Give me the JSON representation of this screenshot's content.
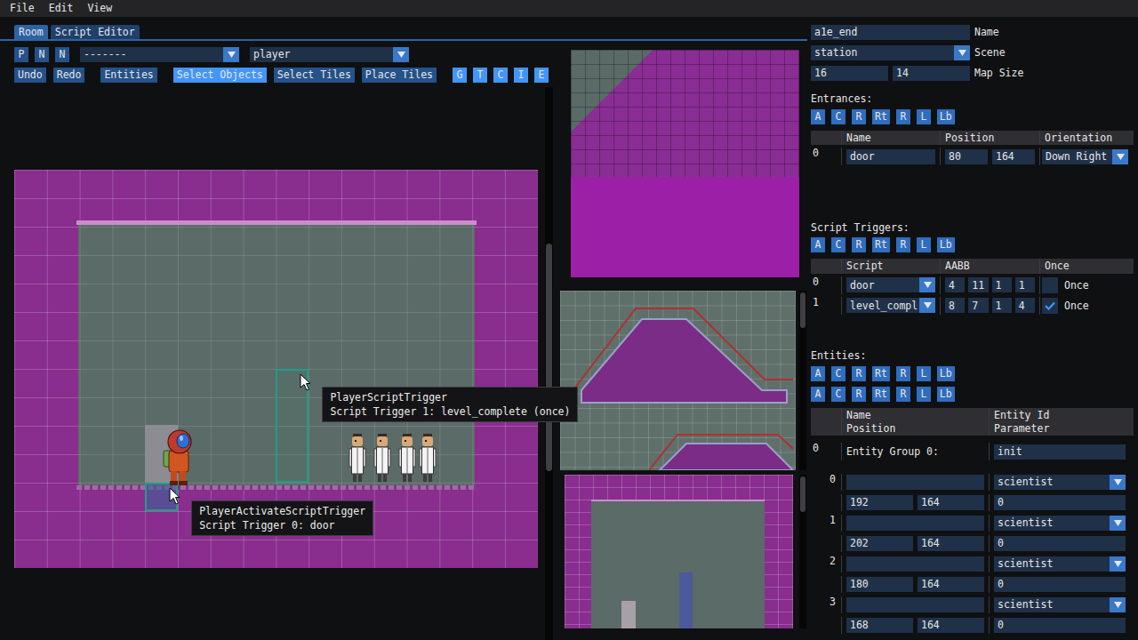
{
  "menu": [
    {
      "label": "File"
    },
    {
      "label": "Edit"
    },
    {
      "label": "View"
    }
  ],
  "tabs": [
    {
      "label": "Room",
      "selected": true
    },
    {
      "label": "Script Editor",
      "selected": false
    }
  ],
  "toolbar": {
    "quick_buttons": [
      "P",
      "N",
      "N"
    ],
    "dropdowns": [
      "-------",
      "player"
    ],
    "action_groups": [
      [
        {
          "label": "Undo",
          "selected": false
        },
        {
          "label": "Redo",
          "selected": false
        }
      ],
      [
        {
          "label": "Entities",
          "selected": false
        }
      ],
      [
        {
          "label": "Select Objects",
          "selected": true
        },
        {
          "label": "Select Tiles",
          "selected": false
        },
        {
          "label": "Place Tiles",
          "selected": false
        }
      ],
      [
        {
          "label": "G",
          "selected": true
        },
        {
          "label": "T",
          "selected": true
        },
        {
          "label": "C",
          "selected": true
        },
        {
          "label": "I",
          "selected": true
        },
        {
          "label": "E",
          "selected": true
        }
      ]
    ]
  },
  "room_view": {
    "scroll": {
      "start": 0.283,
      "size": 0.412
    }
  },
  "room": {
    "fields": [
      {
        "label": "Name",
        "kind": "input",
        "values": [
          "a1e_end"
        ]
      },
      {
        "label": "Scene",
        "kind": "dropdown",
        "values": [
          "station"
        ]
      },
      {
        "label": "Map Size",
        "kind": "pair",
        "values": [
          "16",
          "14"
        ]
      }
    ]
  },
  "entrances": {
    "label": "Entrances:",
    "buttons": [
      "A",
      "C",
      "R",
      "Rt",
      "R",
      "L",
      "Lb"
    ],
    "columns": [
      "Name",
      "Position",
      "Orientation"
    ],
    "rows": [
      {
        "index": "0",
        "name": "door",
        "x": "80",
        "y": "164",
        "orientation": "Down Right"
      }
    ]
  },
  "script_triggers": {
    "label": "Script Triggers:",
    "buttons": [
      "A",
      "C",
      "R",
      "Rt",
      "R",
      "L",
      "Lb"
    ],
    "columns": [
      "Script",
      "AABB",
      "Once"
    ],
    "rows": [
      {
        "index": "0",
        "script": "door",
        "aabb": [
          "4",
          "11",
          "1",
          "1"
        ],
        "once": false,
        "once_label": "Once",
        "tooltip": {
          "title": "PlayerActivateScriptTrigger",
          "text": "Script Trigger 0: door"
        }
      },
      {
        "index": "1",
        "script": "level_compl",
        "aabb": [
          "8",
          "7",
          "1",
          "4"
        ],
        "once": true,
        "once_label": "Once",
        "tooltip": {
          "title": "PlayerScriptTrigger",
          "text": "Script Trigger 1: level_complete (once)"
        }
      }
    ]
  },
  "entities": {
    "label": "Entities:",
    "button_rows": [
      [
        "A",
        "C",
        "R",
        "Rt",
        "R",
        "L",
        "Lb"
      ],
      [
        "A",
        "C",
        "R",
        "Rt",
        "R",
        "L",
        "Lb"
      ]
    ],
    "columns": [
      [
        "Name",
        "Position"
      ],
      [
        "Entity Id",
        "Parameter"
      ]
    ],
    "groups": [
      {
        "index": "0",
        "label": "Entity Group 0:",
        "id": "init",
        "items": [
          {
            "index": "0",
            "name": "",
            "entity_id": "scientist",
            "x": "192",
            "y": "164",
            "parameter": "0"
          },
          {
            "index": "1",
            "name": "",
            "entity_id": "scientist",
            "x": "202",
            "y": "164",
            "parameter": "0"
          },
          {
            "index": "2",
            "name": "",
            "entity_id": "scientist",
            "x": "180",
            "y": "164",
            "parameter": "0"
          },
          {
            "index": "3",
            "name": "",
            "entity_id": "scientist",
            "x": "168",
            "y": "164",
            "parameter": "0"
          }
        ]
      }
    ]
  }
}
